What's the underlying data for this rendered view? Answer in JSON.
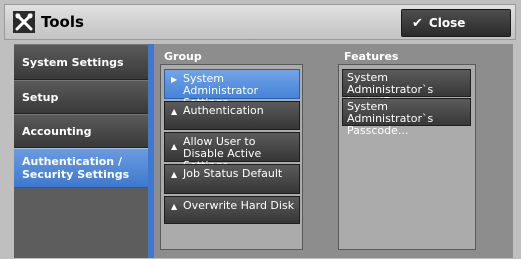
{
  "header": {
    "title": "Tools",
    "close_label": "Close"
  },
  "nav": {
    "items": [
      {
        "label": "System Settings",
        "active": false
      },
      {
        "label": "Setup",
        "active": false
      },
      {
        "label": "Accounting",
        "active": false
      },
      {
        "label": "Authentication / Security Settings",
        "active": true
      }
    ]
  },
  "group": {
    "heading": "Group",
    "items": [
      {
        "label": "System Administrator Settings",
        "active": true
      },
      {
        "label": "Authentication",
        "active": false
      },
      {
        "label": "Allow User to Disable Active Settings...",
        "active": false
      },
      {
        "label": "Job Status Default",
        "active": false
      },
      {
        "label": "Overwrite Hard Disk",
        "active": false
      }
    ]
  },
  "features": {
    "heading": "Features",
    "items": [
      {
        "label": "System Administrator`s Login ID..."
      },
      {
        "label": "System Administrator`s Passcode..."
      }
    ]
  },
  "icons": {
    "tools": "tools-icon",
    "close_check": "checkmark-icon",
    "selected_marker": "right-triangle-icon",
    "item_marker": "up-triangle-icon"
  },
  "colors": {
    "accent": "#3e79cf",
    "button_dark": "#3a3a3a"
  }
}
